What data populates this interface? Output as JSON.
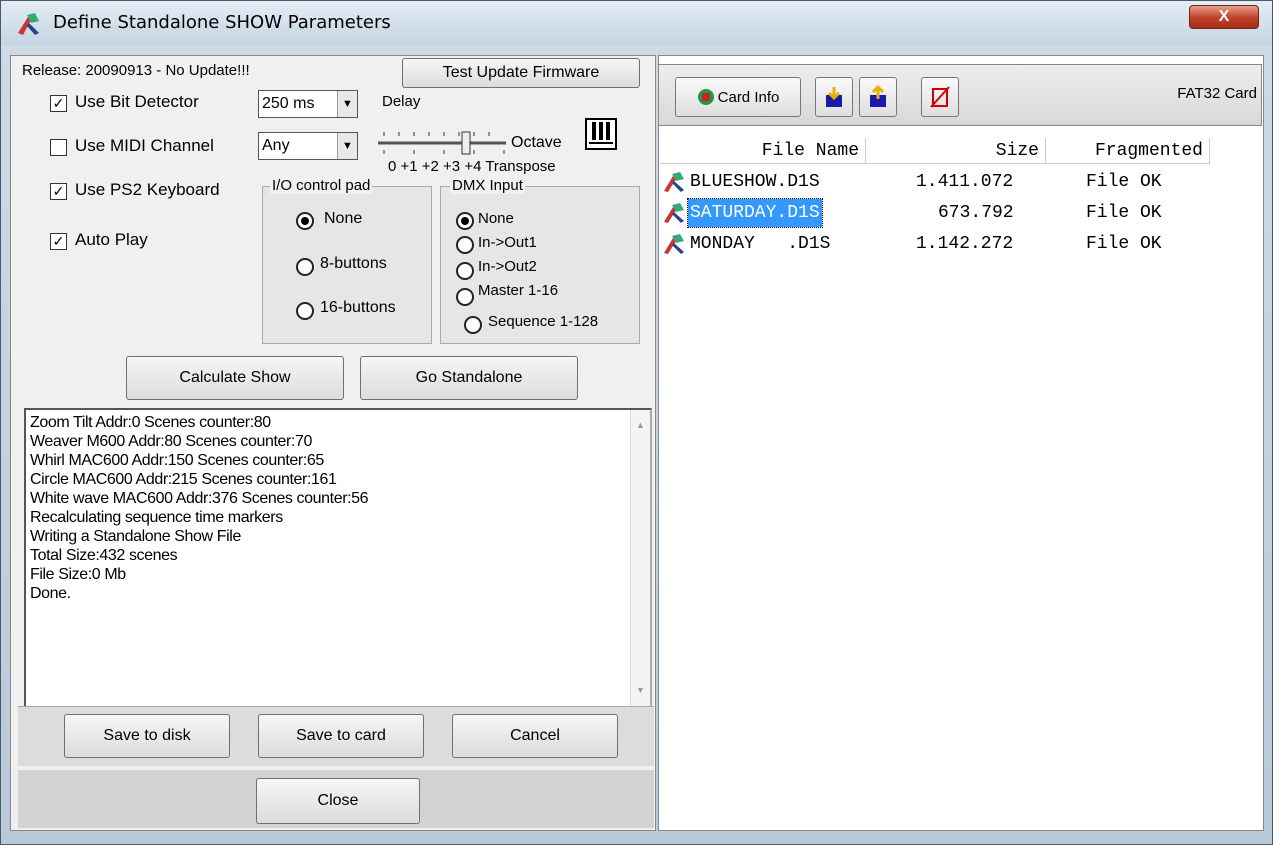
{
  "window": {
    "title": "Define Standalone SHOW Parameters",
    "close_label": "X"
  },
  "release": {
    "text": "Release: 20090913 - No Update!!!",
    "test_button": "Test Update Firmware"
  },
  "options": {
    "bit_detector": {
      "label": "Use Bit Detector",
      "checked": true,
      "value": "250 ms",
      "suffix": "Delay"
    },
    "midi_channel": {
      "label": "Use MIDI Channel",
      "checked": false,
      "value": "Any",
      "octave": "Octave",
      "transpose": "0 +1 +2 +3 +4 Transpose"
    },
    "ps2_keyboard": {
      "label": "Use PS2 Keyboard",
      "checked": true
    },
    "auto_play": {
      "label": "Auto Play",
      "checked": true
    }
  },
  "io_pad": {
    "title": "I/O control pad",
    "items": [
      "None",
      "8-buttons",
      "16-buttons"
    ],
    "selected": 0
  },
  "dmx_input": {
    "title": "DMX Input",
    "items": [
      "None",
      "In->Out1",
      "In->Out2",
      "Master 1-16",
      "Sequence 1-128"
    ],
    "selected": 0
  },
  "actions": {
    "calculate": "Calculate Show",
    "standalone": "Go Standalone"
  },
  "log": [
    "Zoom Tilt Addr:0 Scenes counter:80",
    "Weaver M600 Addr:80 Scenes counter:70",
    "Whirl MAC600 Addr:150 Scenes counter:65",
    "Circle MAC600 Addr:215 Scenes counter:161",
    "White wave MAC600 Addr:376 Scenes counter:56",
    "Recalculating sequence time markers",
    "Writing a Standalone Show File",
    "Total Size:432 scenes",
    "File Size:0 Mb",
    "Done."
  ],
  "footer": {
    "save_disk": "Save to disk",
    "save_card": "Save to card",
    "cancel": "Cancel",
    "close": "Close"
  },
  "card": {
    "info_label": "Card Info",
    "fs_label": "FAT32 Card",
    "columns": [
      "File Name",
      "Size",
      "Fragmented"
    ],
    "files": [
      {
        "name": "BLUESHOW.D1S",
        "size": "1.411.072",
        "status": "File OK",
        "selected": false
      },
      {
        "name": "SATURDAY.D1S",
        "size": "673.792",
        "status": "File OK",
        "selected": true
      },
      {
        "name": "MONDAY   .D1S",
        "size": "1.142.272",
        "status": "File OK",
        "selected": false
      }
    ]
  },
  "colors": {
    "selection": "#3399ff",
    "title_close": "#c04530"
  }
}
